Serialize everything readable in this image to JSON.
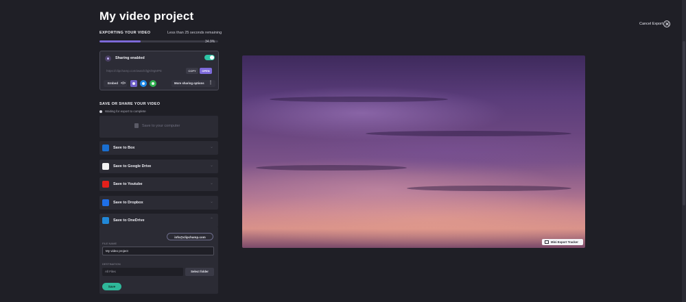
{
  "project": {
    "title": "My video project"
  },
  "export": {
    "label": "EXPORTING YOUR VIDEO",
    "time_remaining": "Less than 25 seconds remaining",
    "progress_percent": 34.9,
    "percent_text": "34.9%"
  },
  "sharing": {
    "label": "Sharing enabled",
    "enabled": true,
    "link": "https://clipchamp.com/watch/lgjKl9gMPE",
    "copy_label": "COPY",
    "open_label": "OPEN",
    "embed_label": "Embed",
    "embed_code": "</>",
    "social_icons": [
      "share-icon",
      "messenger-icon",
      "whatsapp-icon"
    ],
    "more_label": "More sharing options",
    "more_icon": "⋮"
  },
  "save": {
    "title": "SAVE OR SHARE YOUR VIDEO",
    "waiting": "Waiting for export to complete",
    "computer_label": "Save to your computer",
    "destinations": [
      {
        "label": "Save to Box",
        "icon": "box-icon",
        "color": "#1a6fd1"
      },
      {
        "label": "Save to Google Drive",
        "icon": "google-drive-icon",
        "color": "#f2f2f2"
      },
      {
        "label": "Save to Youtube",
        "icon": "youtube-icon",
        "color": "#e3201b"
      },
      {
        "label": "Save to Dropbox",
        "icon": "dropbox-icon",
        "color": "#1e6fe8"
      },
      {
        "label": "Save to OneDrive",
        "icon": "onedrive-icon",
        "color": "#2188d8"
      }
    ],
    "chevron_down": "⌄",
    "chevron_up": "⌃"
  },
  "onedrive": {
    "email": "info@clipchamp.com",
    "file_name_label": "FILE NAME",
    "file_name_value": "My video project",
    "destination_label": "DESTINATION",
    "destination_value": "All Files",
    "select_folder_label": "Select folder",
    "save_label": "Save"
  },
  "header": {
    "cancel_label": "Cancel Export"
  },
  "preview": {
    "mini_tracker_label": "Mini Export Tracker"
  },
  "colors": {
    "accent": "#7d6ad9",
    "toggle_on": "#2ec4a6",
    "save_green": "#2fb89a",
    "background": "#1f1f26"
  }
}
